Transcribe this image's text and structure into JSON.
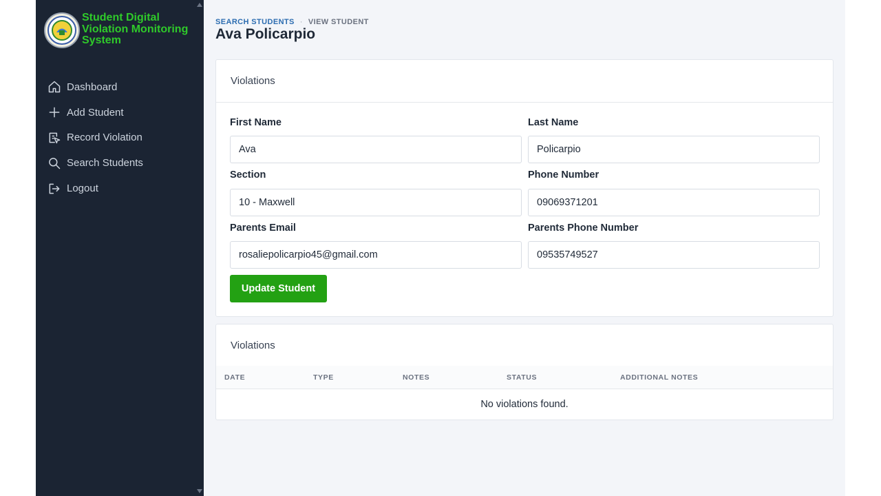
{
  "app": {
    "title_lines": [
      "Student Digital",
      "Violation Monitoring",
      "System"
    ]
  },
  "sidebar": {
    "items": [
      {
        "label": "Dashboard",
        "icon": "home-icon"
      },
      {
        "label": "Add Student",
        "icon": "plus-icon"
      },
      {
        "label": "Record Violation",
        "icon": "record-icon"
      },
      {
        "label": "Search Students",
        "icon": "search-icon"
      },
      {
        "label": "Logout",
        "icon": "logout-icon"
      }
    ]
  },
  "breadcrumb": {
    "parent": "SEARCH STUDENTS",
    "separator": "·",
    "current": "VIEW STUDENT"
  },
  "page": {
    "title": "Ava Policarpio"
  },
  "student_card": {
    "header": "Violations",
    "fields": {
      "first_name": {
        "label": "First Name",
        "value": "Ava"
      },
      "last_name": {
        "label": "Last Name",
        "value": "Policarpio"
      },
      "section": {
        "label": "Section",
        "value": "10 - Maxwell"
      },
      "phone": {
        "label": "Phone Number",
        "value": "09069371201"
      },
      "parents_email": {
        "label": "Parents Email",
        "value": "rosaliepolicarpio45@gmail.com"
      },
      "parents_phone": {
        "label": "Parents Phone Number",
        "value": "09535749527"
      }
    },
    "update_button": "Update Student"
  },
  "violations_card": {
    "header": "Violations",
    "columns": [
      "DATE",
      "TYPE",
      "NOTES",
      "STATUS",
      "ADDITIONAL NOTES"
    ],
    "empty_message": "No violations found."
  },
  "colors": {
    "sidebar_bg": "#1b2433",
    "brand_green": "#2fc92a",
    "button_green": "#23a113",
    "link_blue": "#2b6cb0"
  }
}
